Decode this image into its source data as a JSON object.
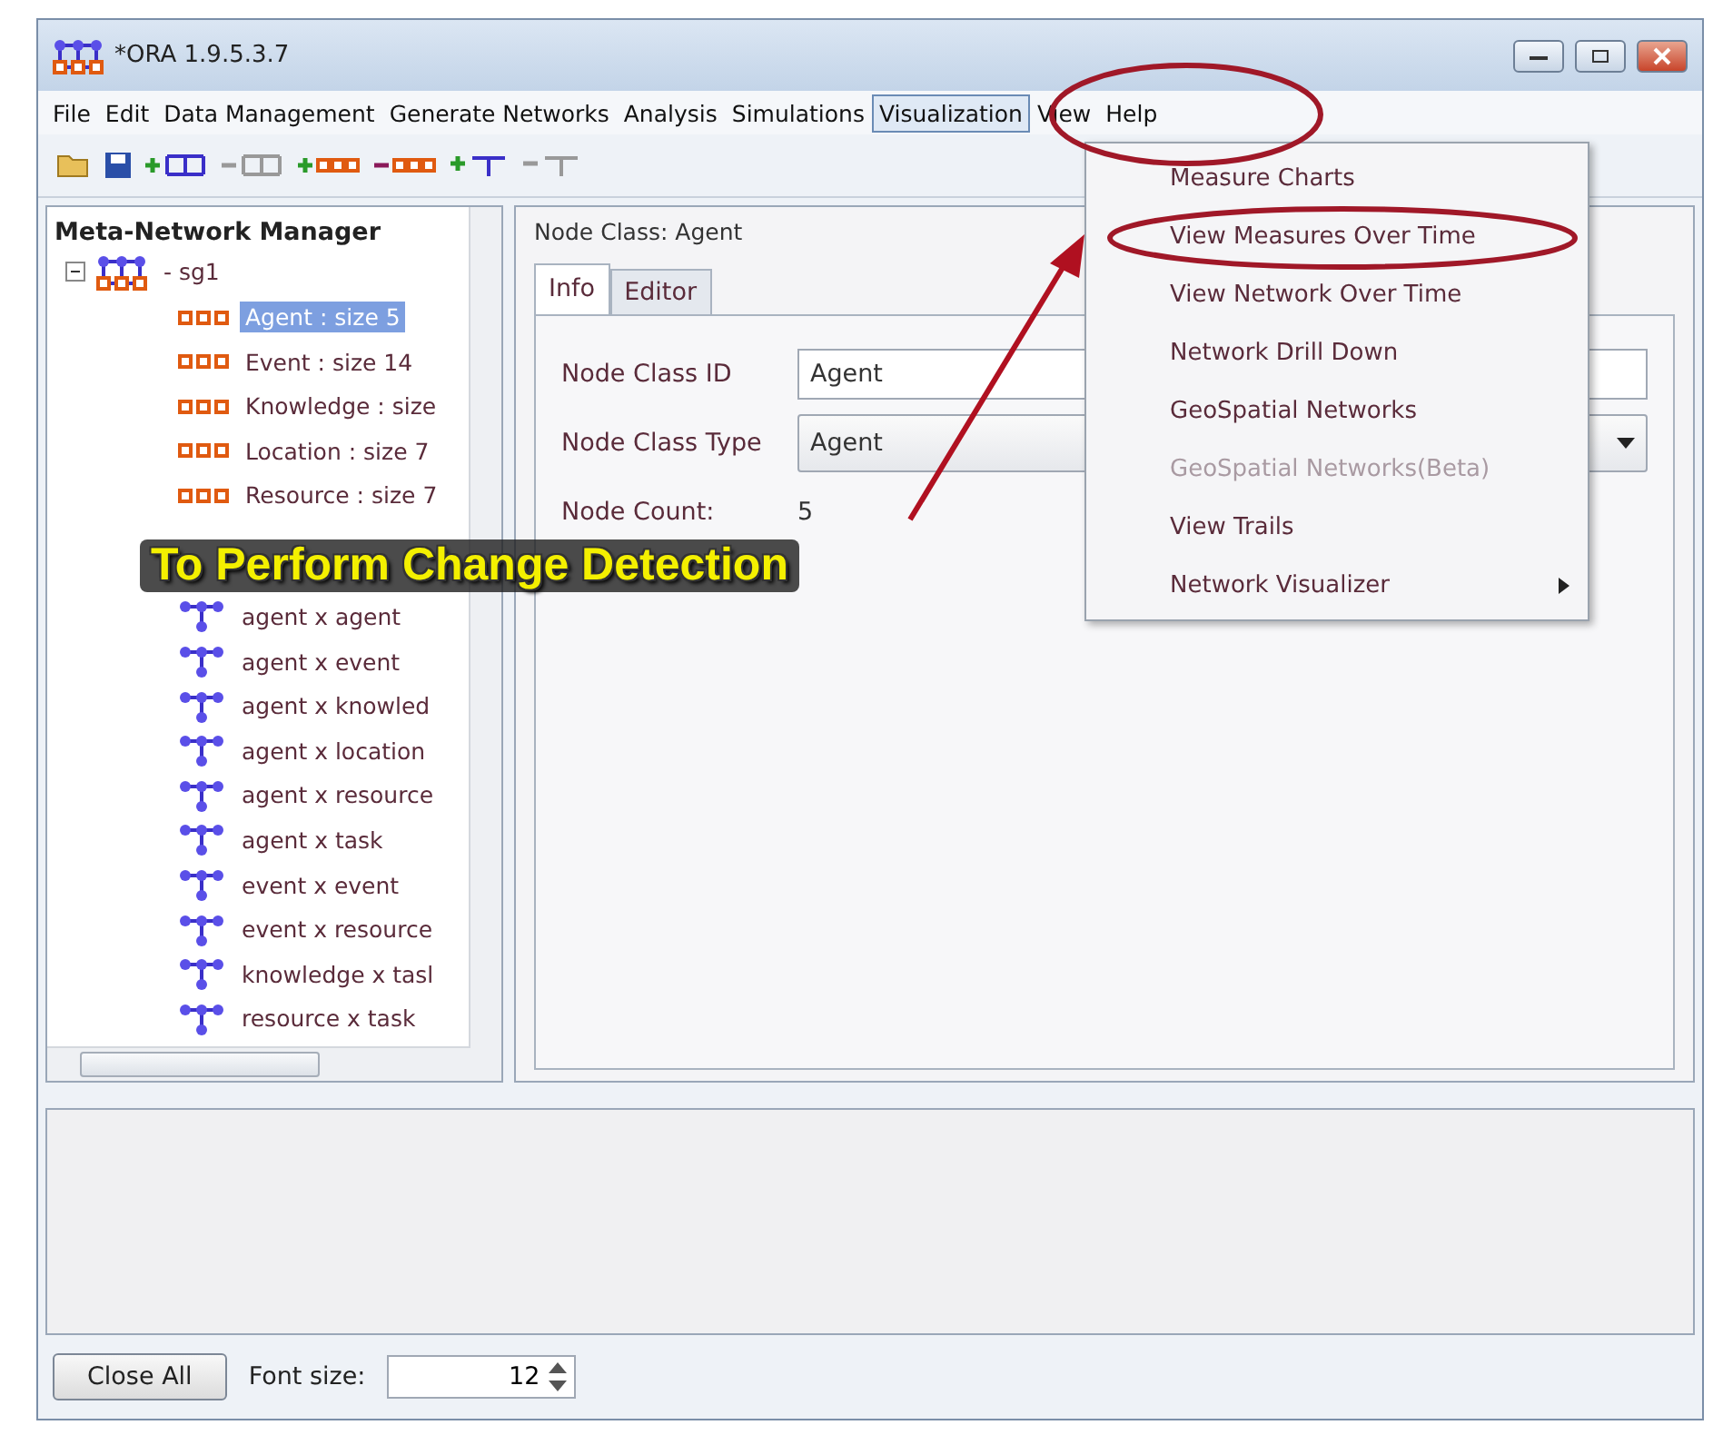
{
  "window": {
    "title": "*ORA 1.9.5.3.7"
  },
  "menu_bar": [
    {
      "label": "File",
      "selected": false
    },
    {
      "label": "Edit",
      "selected": false
    },
    {
      "label": "Data Management",
      "selected": false
    },
    {
      "label": "Generate Networks",
      "selected": false
    },
    {
      "label": "Analysis",
      "selected": false
    },
    {
      "label": "Simulations",
      "selected": false
    },
    {
      "label": "Visualization",
      "selected": true
    },
    {
      "label": "View",
      "selected": false
    },
    {
      "label": "Help",
      "selected": false
    }
  ],
  "dropdown": [
    {
      "label": "Measure Charts",
      "disabled": false,
      "submenu": false
    },
    {
      "label": "View Measures Over Time",
      "disabled": false,
      "submenu": false
    },
    {
      "label": "View Network Over Time",
      "disabled": false,
      "submenu": false
    },
    {
      "label": "Network Drill Down",
      "disabled": false,
      "submenu": false
    },
    {
      "label": "GeoSpatial Networks",
      "disabled": false,
      "submenu": false
    },
    {
      "label": "GeoSpatial Networks(Beta)",
      "disabled": true,
      "submenu": false
    },
    {
      "label": "View Trails",
      "disabled": false,
      "submenu": false
    },
    {
      "label": "Network Visualizer",
      "disabled": false,
      "submenu": true
    }
  ],
  "tree": {
    "title": "Meta-Network Manager",
    "root": {
      "label": "- sg1",
      "expanded": true,
      "children": [
        {
          "label": "Agent : size 5",
          "kind": "node_class",
          "selected": true
        },
        {
          "label": "Event : size 14",
          "kind": "node_class",
          "selected": false
        },
        {
          "label": "Knowledge : size",
          "kind": "node_class",
          "selected": false
        },
        {
          "label": "Location : size 7",
          "kind": "node_class",
          "selected": false
        },
        {
          "label": "Resource : size 7",
          "kind": "node_class",
          "selected": false
        },
        {
          "label": "agent x agent",
          "kind": "network",
          "selected": false
        },
        {
          "label": "agent x event",
          "kind": "network",
          "selected": false
        },
        {
          "label": "agent x knowled",
          "kind": "network",
          "selected": false
        },
        {
          "label": "agent x location",
          "kind": "network",
          "selected": false
        },
        {
          "label": "agent x resource",
          "kind": "network",
          "selected": false
        },
        {
          "label": "agent x task",
          "kind": "network",
          "selected": false
        },
        {
          "label": "event x event",
          "kind": "network",
          "selected": false
        },
        {
          "label": "event x resource",
          "kind": "network",
          "selected": false
        },
        {
          "label": "knowledge x tasl",
          "kind": "network",
          "selected": false
        },
        {
          "label": "resource x task",
          "kind": "network",
          "selected": false
        }
      ]
    }
  },
  "editor": {
    "title": "Node Class: Agent",
    "tabs": [
      {
        "label": "Info",
        "selected": true
      },
      {
        "label": "Editor",
        "selected": false
      }
    ],
    "fields": [
      {
        "label": "Node Class ID",
        "kind": "text",
        "value": "Agent"
      },
      {
        "label": "Node Class Type",
        "kind": "select",
        "value": "Agent"
      },
      {
        "label": "Node Count:",
        "kind": "plain",
        "value": "5"
      }
    ]
  },
  "caption": "To Perform Change Detection",
  "footer": {
    "button": "Close All",
    "font_size_label": "Font size:",
    "font_size_value": "12"
  }
}
